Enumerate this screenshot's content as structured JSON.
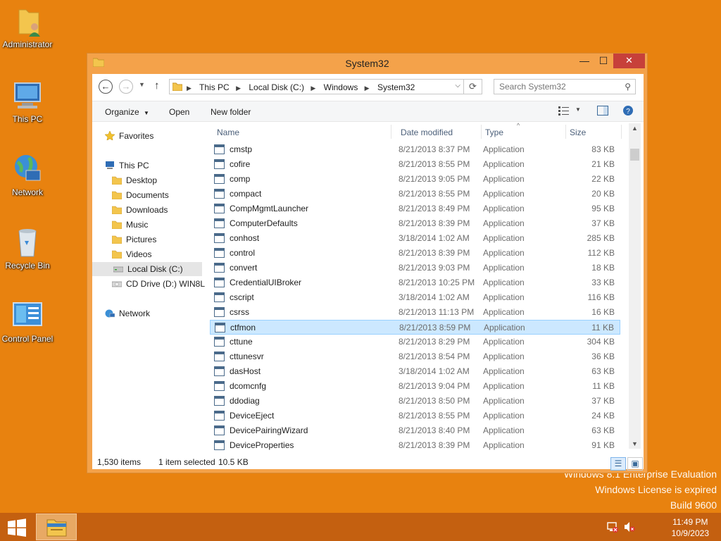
{
  "desktop": {
    "icons": [
      {
        "label": "Administrator",
        "icon": "user-folder-icon"
      },
      {
        "label": "This PC",
        "icon": "computer-icon"
      },
      {
        "label": "Network",
        "icon": "network-globe-icon"
      },
      {
        "label": "Recycle Bin",
        "icon": "recycle-bin-icon"
      },
      {
        "label": "Control Panel",
        "icon": "control-panel-icon"
      }
    ],
    "watermark": {
      "line1": "Windows 8.1 Enterprise Evaluation",
      "line2": "Windows License is expired",
      "line3": "Build 9600"
    }
  },
  "window": {
    "title": "System32",
    "controls": {
      "minimize": "—",
      "maximize": "☐",
      "close": "✕"
    },
    "address": {
      "crumbs": [
        "This PC",
        "Local Disk (C:)",
        "Windows",
        "System32"
      ]
    },
    "search": {
      "placeholder": "Search System32"
    },
    "toolbar": {
      "organize": "Organize",
      "open": "Open",
      "new_folder": "New folder"
    },
    "nav": {
      "favorites": "Favorites",
      "this_pc": "This PC",
      "items": [
        "Desktop",
        "Documents",
        "Downloads",
        "Music",
        "Pictures",
        "Videos",
        "Local Disk (C:)",
        "CD Drive (D:) WIN8L"
      ],
      "network": "Network"
    },
    "columns": {
      "name": "Name",
      "date": "Date modified",
      "type": "Type",
      "size": "Size"
    },
    "files": [
      {
        "name": "cmstp",
        "date": "8/21/2013 8:37 PM",
        "type": "Application",
        "size": "83 KB"
      },
      {
        "name": "cofire",
        "date": "8/21/2013 8:55 PM",
        "type": "Application",
        "size": "21 KB"
      },
      {
        "name": "comp",
        "date": "8/21/2013 9:05 PM",
        "type": "Application",
        "size": "22 KB"
      },
      {
        "name": "compact",
        "date": "8/21/2013 8:55 PM",
        "type": "Application",
        "size": "20 KB"
      },
      {
        "name": "CompMgmtLauncher",
        "date": "8/21/2013 8:49 PM",
        "type": "Application",
        "size": "95 KB"
      },
      {
        "name": "ComputerDefaults",
        "date": "8/21/2013 8:39 PM",
        "type": "Application",
        "size": "37 KB"
      },
      {
        "name": "conhost",
        "date": "3/18/2014 1:02 AM",
        "type": "Application",
        "size": "285 KB"
      },
      {
        "name": "control",
        "date": "8/21/2013 8:39 PM",
        "type": "Application",
        "size": "112 KB"
      },
      {
        "name": "convert",
        "date": "8/21/2013 9:03 PM",
        "type": "Application",
        "size": "18 KB"
      },
      {
        "name": "CredentialUIBroker",
        "date": "8/21/2013 10:25 PM",
        "type": "Application",
        "size": "33 KB"
      },
      {
        "name": "cscript",
        "date": "3/18/2014 1:02 AM",
        "type": "Application",
        "size": "116 KB"
      },
      {
        "name": "csrss",
        "date": "8/21/2013 11:13 PM",
        "type": "Application",
        "size": "16 KB"
      },
      {
        "name": "ctfmon",
        "date": "8/21/2013 8:59 PM",
        "type": "Application",
        "size": "11 KB"
      },
      {
        "name": "cttune",
        "date": "8/21/2013 8:29 PM",
        "type": "Application",
        "size": "304 KB"
      },
      {
        "name": "cttunesvr",
        "date": "8/21/2013 8:54 PM",
        "type": "Application",
        "size": "36 KB"
      },
      {
        "name": "dasHost",
        "date": "3/18/2014 1:02 AM",
        "type": "Application",
        "size": "63 KB"
      },
      {
        "name": "dcomcnfg",
        "date": "8/21/2013 9:04 PM",
        "type": "Application",
        "size": "11 KB"
      },
      {
        "name": "ddodiag",
        "date": "8/21/2013 8:50 PM",
        "type": "Application",
        "size": "37 KB"
      },
      {
        "name": "DeviceEject",
        "date": "8/21/2013 8:55 PM",
        "type": "Application",
        "size": "24 KB"
      },
      {
        "name": "DevicePairingWizard",
        "date": "8/21/2013 8:40 PM",
        "type": "Application",
        "size": "63 KB"
      },
      {
        "name": "DeviceProperties",
        "date": "8/21/2013 8:39 PM",
        "type": "Application",
        "size": "91 KB"
      }
    ],
    "selected_file": "ctfmon",
    "status": {
      "count": "1,530 items",
      "selected": "1 item selected",
      "size": "10.5 KB"
    }
  },
  "taskbar": {
    "clock_time": "11:49 PM",
    "clock_date": "10/9/2023"
  },
  "colors": {
    "desktop": "#e8820f",
    "window_frame": "#f4a24a",
    "selection": "#cce8ff",
    "taskbar": "#c46010"
  }
}
